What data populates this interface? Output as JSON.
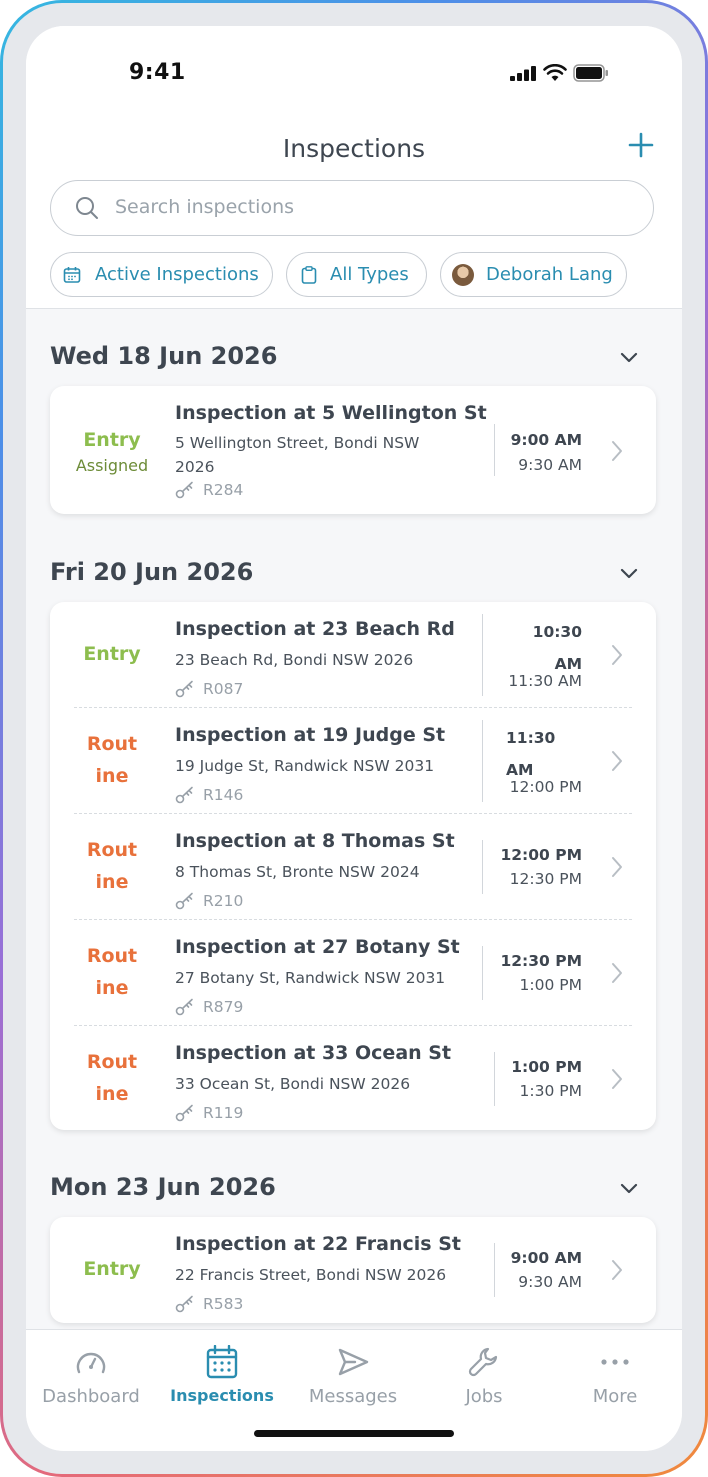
{
  "status_bar": {
    "time": "9:41"
  },
  "header": {
    "title": "Inspections",
    "search_placeholder": "Search inspections",
    "filters": [
      {
        "label": "Active Inspections",
        "icon": "calendar-icon"
      },
      {
        "label": "All Types",
        "icon": "clipboard-icon"
      },
      {
        "label": "Deborah Lang",
        "icon": "avatar"
      }
    ]
  },
  "colors": {
    "accent": "#2a8db0",
    "entry": "#8dbd4e",
    "routine": "#e8713b",
    "assigned": "#6d8c38"
  },
  "sections": [
    {
      "date": "Wed 18 Jun 2026",
      "items": [
        {
          "type": "Entry",
          "status": "Assigned",
          "title": "Inspection at 5 Wellington St",
          "address_line1": "5 Wellington Street, Bondi NSW",
          "address_line2": "2026",
          "ref": "R284",
          "start": "9:00 AM",
          "end": "9:30 AM"
        }
      ]
    },
    {
      "date": "Fri 20 Jun 2026",
      "items": [
        {
          "type_line1": "Entry",
          "title": "Inspection at 23 Beach Rd",
          "address": "23 Beach Rd, Bondi NSW 2026",
          "ref": "R087",
          "start_line1": "10:30",
          "start_line2": "AM",
          "end": "11:30 AM"
        },
        {
          "type_line1": "Rout",
          "type_line2": "ine",
          "title": "Inspection at 19 Judge St",
          "address": "19 Judge St, Randwick NSW 2031",
          "ref": "R146",
          "start_line1": "11:30",
          "start_line2": "AM",
          "end": "12:00 PM"
        },
        {
          "type_line1": "Rout",
          "type_line2": "ine",
          "title": "Inspection at 8 Thomas St",
          "address": "8 Thomas St, Bronte NSW 2024",
          "ref": "R210",
          "start": "12:00 PM",
          "end": "12:30 PM"
        },
        {
          "type_line1": "Rout",
          "type_line2": "ine",
          "title": "Inspection at 27 Botany St",
          "address": "27 Botany St, Randwick NSW 2031",
          "ref": "R879",
          "start": "12:30 PM",
          "end": "1:00 PM"
        },
        {
          "type_line1": "Rout",
          "type_line2": "ine",
          "title": "Inspection at 33 Ocean St",
          "address": "33 Ocean St, Bondi NSW 2026",
          "ref": "R119",
          "start": "1:00 PM",
          "end": "1:30 PM"
        }
      ]
    },
    {
      "date": "Mon 23 Jun 2026",
      "items": [
        {
          "type": "Entry",
          "title": "Inspection at 22 Francis St",
          "address": "22 Francis Street, Bondi NSW 2026",
          "ref": "R583",
          "start": "9:00 AM",
          "end": "9:30 AM"
        }
      ]
    }
  ],
  "tabs": [
    {
      "label": "Dashboard",
      "icon": "gauge-icon",
      "active": false
    },
    {
      "label": "Inspections",
      "icon": "calendar-icon",
      "active": true
    },
    {
      "label": "Messages",
      "icon": "send-icon",
      "active": false
    },
    {
      "label": "Jobs",
      "icon": "wrench-icon",
      "active": false
    },
    {
      "label": "More",
      "icon": "more-icon",
      "active": false
    }
  ]
}
